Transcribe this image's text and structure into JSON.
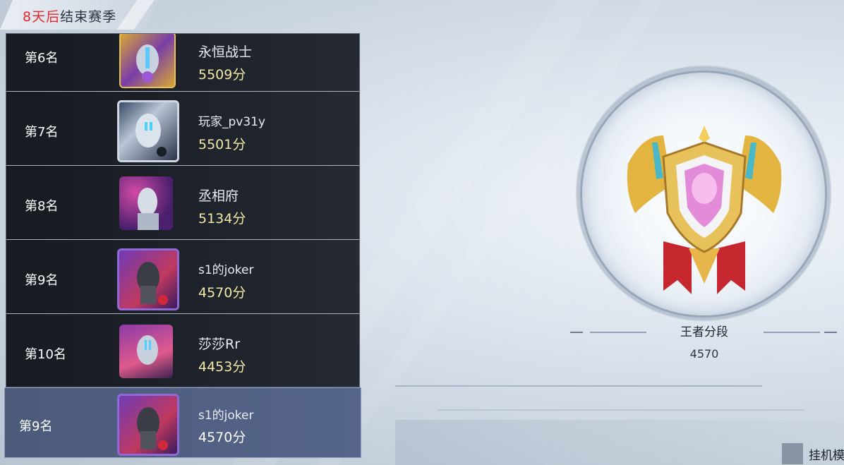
{
  "season": {
    "days_left": "8天后",
    "suffix": "结束赛季"
  },
  "rankings": [
    {
      "rank": "第6名",
      "name": "永恒战士",
      "score": "5509分",
      "avatar": "ultraman-gold-avatar"
    },
    {
      "rank": "第7名",
      "name": "玩家_pv31y",
      "score": "5501分",
      "avatar": "ultraman-silver-avatar"
    },
    {
      "rank": "第8名",
      "name": "丞相府",
      "score": "5134分",
      "avatar": "ultraman-galaxy-avatar"
    },
    {
      "rank": "第9名",
      "name": "s1的joker",
      "score": "4570分",
      "avatar": "dark-knight-avatar"
    },
    {
      "rank": "第10名",
      "name": "莎莎Rr",
      "score": "4453分",
      "avatar": "ultraman-zero-avatar"
    }
  ],
  "my_rank": {
    "rank": "第9名",
    "name": "s1的joker",
    "score": "4570分",
    "avatar": "dark-knight-avatar"
  },
  "tier": {
    "name": "王者分段",
    "score": "4570"
  },
  "afk": {
    "label": "挂机模"
  },
  "colors": {
    "highlight_red": "#e5272d",
    "score_yellow": "#f2e9a6",
    "my_row": "#4c5a7a"
  }
}
